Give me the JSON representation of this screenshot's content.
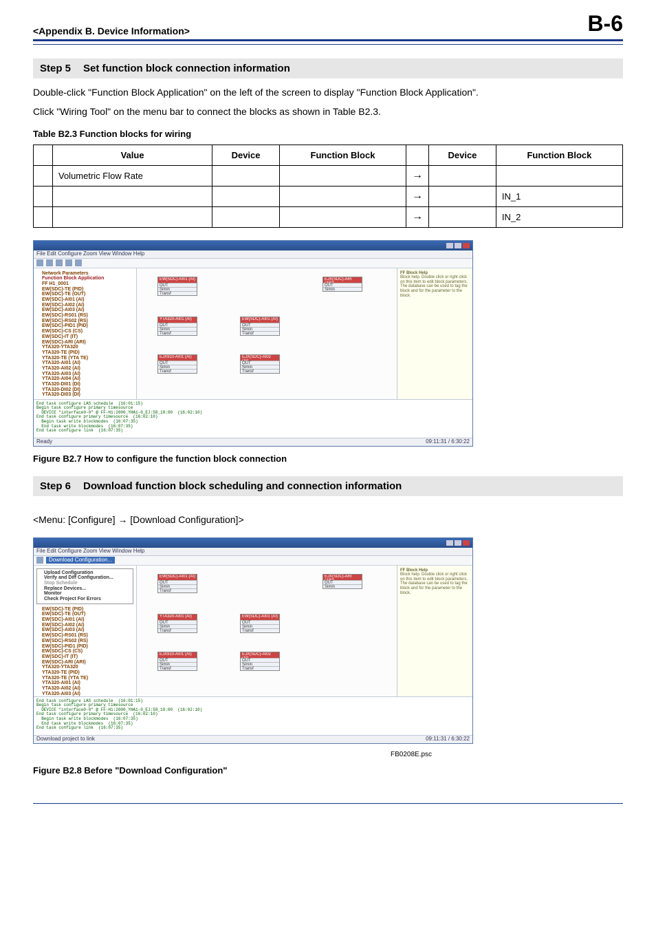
{
  "header": {
    "left": "<Appendix B.  Device Information>",
    "right": "B-6"
  },
  "step5": {
    "label": "Step 5",
    "title": "Set function block connection information",
    "para1": "Double-click \"Function Block Application\" on the left of the screen to display \"Function Block Application\".",
    "para2": "Click \"Wiring Tool\" on the menu bar to connect the blocks as shown in Table B2.3."
  },
  "tableB23": {
    "caption": "Table B2.3     Function blocks for wiring",
    "headers": {
      "value": "Value",
      "device": "Device",
      "fnblock": "Function Block",
      "device2": "Device",
      "fnblock2": "Function Block"
    },
    "rows": [
      {
        "value": "Volumetric Flow Rate",
        "device": "",
        "fb": "",
        "arrow": "→",
        "device2": "",
        "fb2": ""
      },
      {
        "value": "",
        "device": "",
        "fb": "",
        "arrow": "→",
        "device2": "",
        "fb2": "IN_1"
      },
      {
        "value": "",
        "device": "",
        "fb": "",
        "arrow": "→",
        "device2": "",
        "fb2": "IN_2"
      }
    ]
  },
  "figureB27": {
    "caption": "Figure B2.7     How to configure the function block connection"
  },
  "step6": {
    "label": "Step 6",
    "title": "Download function block scheduling and connection information"
  },
  "menuPath": "<Menu: [Configure] → [Download Configuration]>",
  "figureB28": {
    "caption": "Figure B2.8     Before \"Download Configuration\"",
    "tag": "FB0208E.psc"
  },
  "fakeui": {
    "menubar": "File  Edit  Configure  Zoom  View  Window  Help",
    "treeTop": "Network Parameters",
    "treeItems": [
      "Function Block Application",
      "FF H1_0001",
      "EW(SDC)-TE (PID)",
      "EW(SDC)-TE (OUT)",
      "EW(SDC)-AI01 (AI)",
      "EW(SDC)-AI02 (AI)",
      "EW(SDC)-AI03 (AI)",
      "EW(SDC)-RS01 (RS)",
      "EW(SDC)-RS02 (RS)",
      "EW(SDC)-PID1 (PID)",
      "EW(SDC)-CS (CS)",
      "EW(SDC)-IT (IT)",
      "EW(SDC)-ARI (ARI)",
      "YTA320-YTA320",
      "YTA320-TE (PID)",
      "YTA320-TE (YTA TE)",
      "YTA320-AI01 (AI)",
      "YTA320-AI02 (AI)",
      "YTA320-AI03 (AI)",
      "YTA320-AI04 (AI)",
      "YTA320-DI01 (DI)",
      "YTA320-DI02 (DI)",
      "YTA320-DI03 (DI)"
    ],
    "helpTitle": "FF Block Help",
    "helpBody": "Block help. Double click or right click on this item to edit block parameters. The database can be used to tag the block and for the parameter to the block.",
    "blocks": {
      "b1": "EW(SDC)-AI01 (AI)",
      "b2": "YTA320-AI01 (AI)",
      "b3": "EJX910-AI01 (AI)",
      "b4": "EW(SDC)-AI01 (AI)",
      "b5": "EJX(SDC)-ARI (ARI)",
      "b6": "EJX(SDC)-AI02 (AI)"
    },
    "blockRows": {
      "out": "OUT",
      "simin": "Simin",
      "transf": "Transf"
    },
    "log": "End task configure LAS schedule  (16:01:15)\nBegin task configure primary timesource\n  DEVICE \"interface0-0\" @ FF-H1:2000_YHA1-0_EJ:58_10:00  (16:02:10)\nEnd task configure primary timesource  (16:02:10)\n  Begin task write blockmodes  (16:07:35)\n  End task write blockmodes  (16:07:35)\nEnd task configure link  (16:07:35)",
    "status_left": "Ready",
    "status_right": "09:11:31 / 6:30:22",
    "cfgMenu": "Download Configuration...",
    "cfgMenuItems": [
      "Upload Configuration",
      "Verify and Diff Configuration...",
      "Stop Schedule",
      "Replace Devices...",
      "Monitor",
      "Check Project For Errors"
    ],
    "status2_left": "Download project to link",
    "status2_right": "09:11:31 / 6:30:22"
  }
}
